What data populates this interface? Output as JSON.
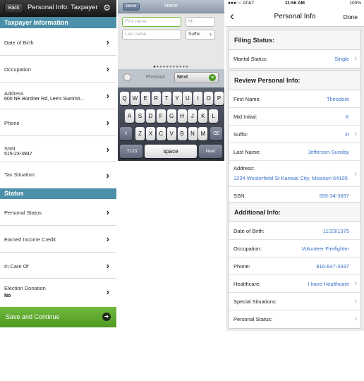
{
  "left": {
    "back_label": "Back",
    "title": "Personal Info: Taxpayer",
    "gear_icon": "gear-icon",
    "section1": "Taxpayer Information",
    "rows1": [
      {
        "label": "Date of Birth",
        "value": ""
      },
      {
        "label": "Occupation",
        "value": ""
      },
      {
        "label": "Address",
        "value": "600 NE Bordner Rd, Lee's Summit..."
      },
      {
        "label": "Phone",
        "value": ""
      },
      {
        "label": "SSN",
        "value": "515-23-3947"
      },
      {
        "label": "Tax Situation",
        "value": ""
      }
    ],
    "section2": "Status",
    "rows2": [
      {
        "label": "Personal Status",
        "value": ""
      },
      {
        "label": "Earned Income Credit",
        "value": ""
      },
      {
        "label": "In Care Of",
        "value": ""
      },
      {
        "label": "Election Donation",
        "value": "No"
      }
    ],
    "save_label": "Save and Continue",
    "accent": "#4b8fa8",
    "save_color": "#5da82c"
  },
  "middle": {
    "done_label": "Done",
    "title": "Name",
    "first_name_placeholder": "First name",
    "mi_placeholder": "MI",
    "last_name_placeholder": "Last name",
    "suffix_label": "Suffix",
    "previous_label": "Previous",
    "next_label": "Next",
    "keyboard": {
      "row1": [
        "Q",
        "W",
        "E",
        "R",
        "T",
        "Y",
        "U",
        "I",
        "O",
        "P"
      ],
      "row2": [
        "A",
        "S",
        "D",
        "F",
        "G",
        "H",
        "J",
        "K",
        "L"
      ],
      "row3": [
        "Z",
        "X",
        "C",
        "V",
        "B",
        "N",
        "M"
      ],
      "numbers_key": ".?123",
      "space_key": "space",
      "next_key": "Next"
    }
  },
  "right": {
    "status": {
      "carrier": "●●●○○ AT&T",
      "time": "11:56 AM",
      "battery": "100%"
    },
    "title": "Personal Info",
    "done_label": "Done",
    "filing": {
      "header": "Filing Status:",
      "rows": [
        {
          "label": "Marital Status:",
          "value": "Single"
        }
      ]
    },
    "review": {
      "header": "Review Personal Info:",
      "rows": [
        {
          "label": "First Name:",
          "value": "Theodore"
        },
        {
          "label": "Mid Initial:",
          "value": "K"
        },
        {
          "label": "Suffix:",
          "value": "Jr"
        },
        {
          "label": "Last Name:",
          "value": "Jefferson-Sunday"
        },
        {
          "label": "Address:",
          "value": "1234 Westerfield St Kansas City, Missouri 64105"
        },
        {
          "label": "SSN:",
          "value": "555-34-3837"
        }
      ]
    },
    "additional": {
      "header": "Additional Info:",
      "rows": [
        {
          "label": "Date of Birth:",
          "value": "11/23/1975"
        },
        {
          "label": "Occupation:",
          "value": "Volunteer Firefighter"
        },
        {
          "label": "Phone:",
          "value": "816-847-3937"
        },
        {
          "label": "Healthcare:",
          "value": "I have Healthcare"
        },
        {
          "label": "Special Situations:",
          "value": ""
        },
        {
          "label": "Personal Status:",
          "value": ""
        }
      ]
    },
    "link_color": "#3b72c8"
  }
}
